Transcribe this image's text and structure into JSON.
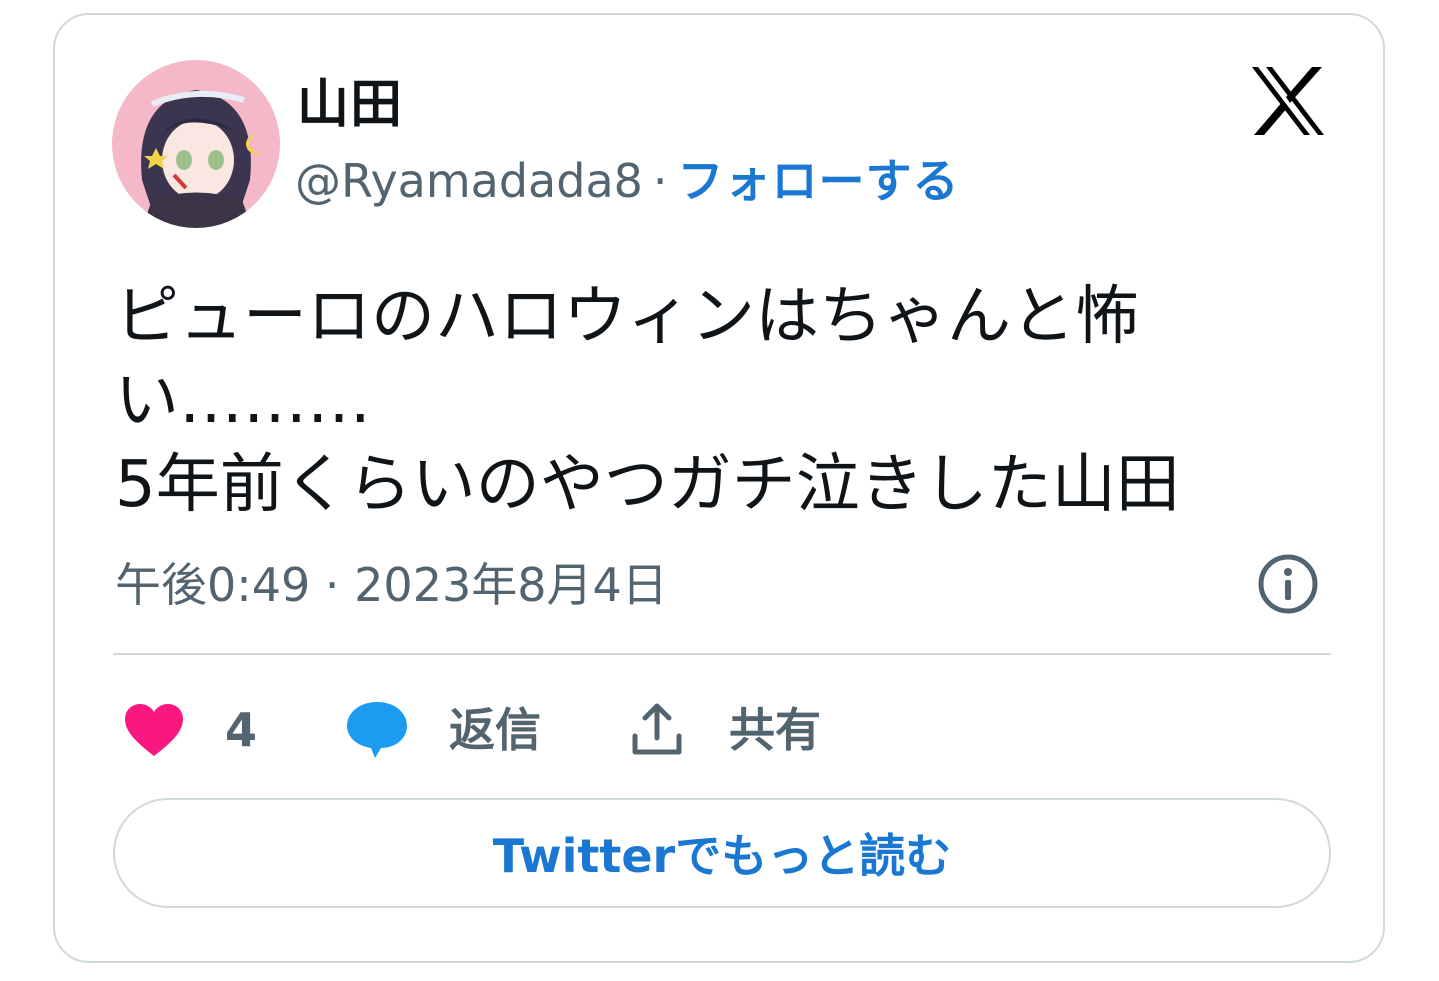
{
  "author": {
    "display_name": "山田",
    "handle": "@Ryamadada8",
    "separator": "·",
    "follow_label": "フォローする",
    "avatar_icon": "profile-avatar"
  },
  "platform_icon": "x-logo-icon",
  "tweet": {
    "text_line1": "ピューロのハロウィンはちゃんと怖",
    "text_line2": "い………",
    "text_line3": "5年前くらいのやつガチ泣きした山田",
    "timestamp": "午後0:49 · 2023年8月4日"
  },
  "actions": {
    "like_count": "4",
    "reply_label": "返信",
    "share_label": "共有"
  },
  "read_more_label": "Twitterでもっと読む",
  "colors": {
    "accent": "#1a78d3",
    "like": "#f91880",
    "reply": "#1d9bf0",
    "muted": "#536471",
    "border": "#cfd9de"
  }
}
